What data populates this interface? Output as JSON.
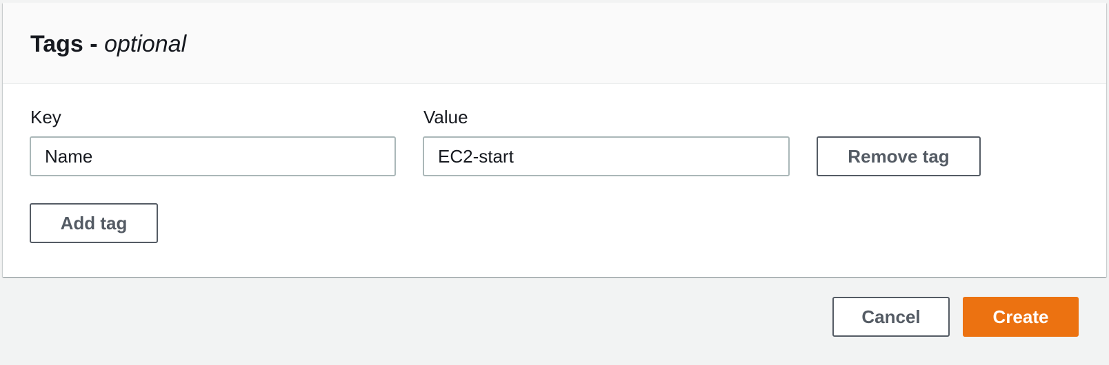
{
  "tags_section": {
    "title": "Tags -",
    "title_suffix": "optional",
    "key_label": "Key",
    "value_label": "Value",
    "rows": [
      {
        "key": "Name",
        "value": "EC2-start"
      }
    ],
    "remove_tag_label": "Remove tag",
    "add_tag_label": "Add tag"
  },
  "footer": {
    "cancel_label": "Cancel",
    "create_label": "Create"
  },
  "colors": {
    "page_background": "#f2f3f3",
    "primary_button": "#ec7211",
    "secondary_button_text": "#545b64",
    "input_border": "#aab7b8"
  }
}
